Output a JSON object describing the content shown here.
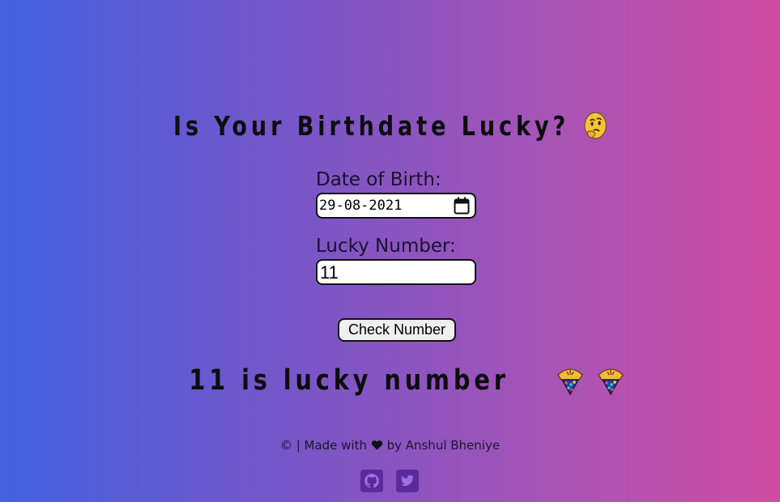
{
  "header": {
    "title": "Is Your Birthdate Lucky?",
    "title_emoji": "thinking-face-icon"
  },
  "form": {
    "dob_label": "Date of Birth:",
    "dob_value": "29-08-2021",
    "lucky_label": "Lucky Number:",
    "lucky_value": "11",
    "check_button_label": "Check Number"
  },
  "result": {
    "text": "11 is lucky number",
    "emoji": "party-popper-icon"
  },
  "footer": {
    "prefix": "© | Made with",
    "suffix": "by Anshul Bheniye",
    "heart_icon": "heart-icon"
  },
  "social": {
    "github_icon": "github-icon",
    "twitter_icon": "twitter-icon",
    "icon_color": "#5b2a9c"
  },
  "colors": {
    "gradient_start": "#4361e0",
    "gradient_end": "#cf4ca1"
  }
}
